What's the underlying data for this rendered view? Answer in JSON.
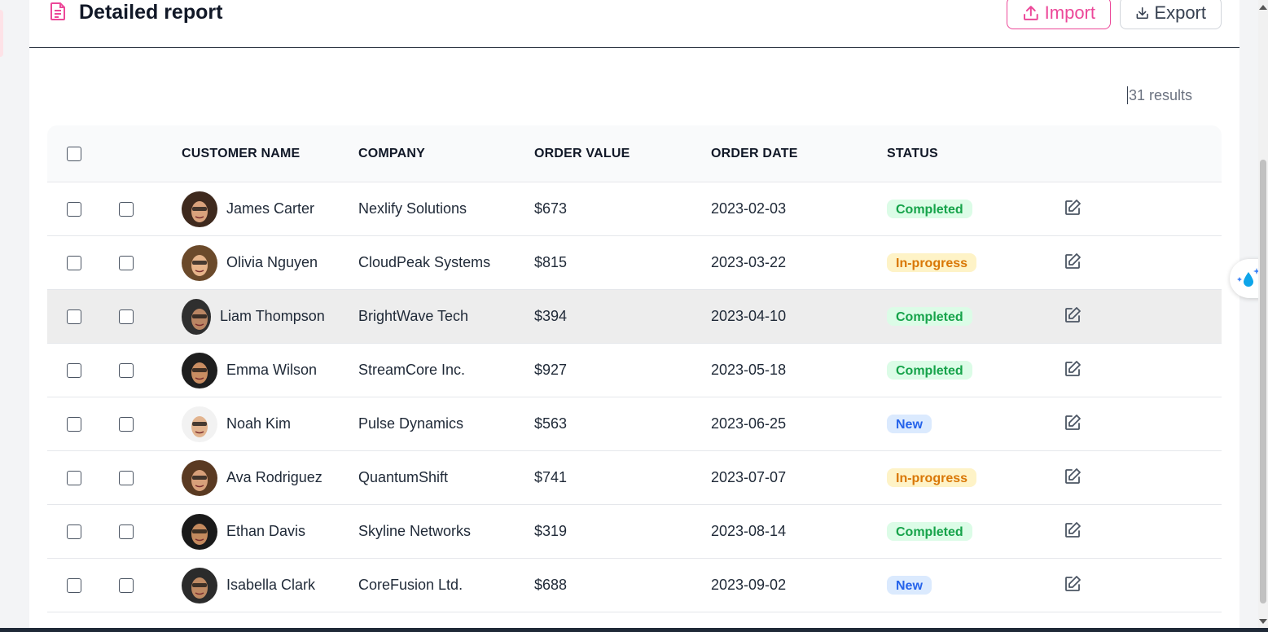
{
  "header": {
    "title": "Detailed report",
    "import_label": "Import",
    "export_label": "Export"
  },
  "results_text": "31 results",
  "table": {
    "columns": [
      "CUSTOMER NAME",
      "COMPANY",
      "ORDER VALUE",
      "ORDER DATE",
      "STATUS"
    ],
    "rows": [
      {
        "name": "James Carter",
        "company": "Nexlify Solutions",
        "value": "$673",
        "date": "2023-02-03",
        "status": "Completed"
      },
      {
        "name": "Olivia Nguyen",
        "company": "CloudPeak Systems",
        "value": "$815",
        "date": "2023-03-22",
        "status": "In-progress"
      },
      {
        "name": "Liam Thompson",
        "company": "BrightWave Tech",
        "value": "$394",
        "date": "2023-04-10",
        "status": "Completed"
      },
      {
        "name": "Emma Wilson",
        "company": "StreamCore Inc.",
        "value": "$927",
        "date": "2023-05-18",
        "status": "Completed"
      },
      {
        "name": "Noah Kim",
        "company": "Pulse Dynamics",
        "value": "$563",
        "date": "2023-06-25",
        "status": "New"
      },
      {
        "name": "Ava Rodriguez",
        "company": "QuantumShift",
        "value": "$741",
        "date": "2023-07-07",
        "status": "In-progress"
      },
      {
        "name": "Ethan Davis",
        "company": "Skyline Networks",
        "value": "$319",
        "date": "2023-08-14",
        "status": "Completed"
      },
      {
        "name": "Isabella Clark",
        "company": "CoreFusion Ltd.",
        "value": "$688",
        "date": "2023-09-02",
        "status": "New"
      }
    ]
  },
  "status_colors": {
    "Completed": {
      "bg": "#dcfce7",
      "fg": "#16a34a"
    },
    "In-progress": {
      "bg": "#fef3c7",
      "fg": "#d97706"
    },
    "New": {
      "bg": "#dbeafe",
      "fg": "#2563eb"
    }
  },
  "colors": {
    "accent": "#ec4899",
    "border": "#e5e7eb",
    "hover_row": "#ededed"
  },
  "icons": {
    "report": "document-icon",
    "import": "upload-icon",
    "export": "download-icon",
    "edit": "edit-icon",
    "floating": "sparkle-drop-icon"
  }
}
